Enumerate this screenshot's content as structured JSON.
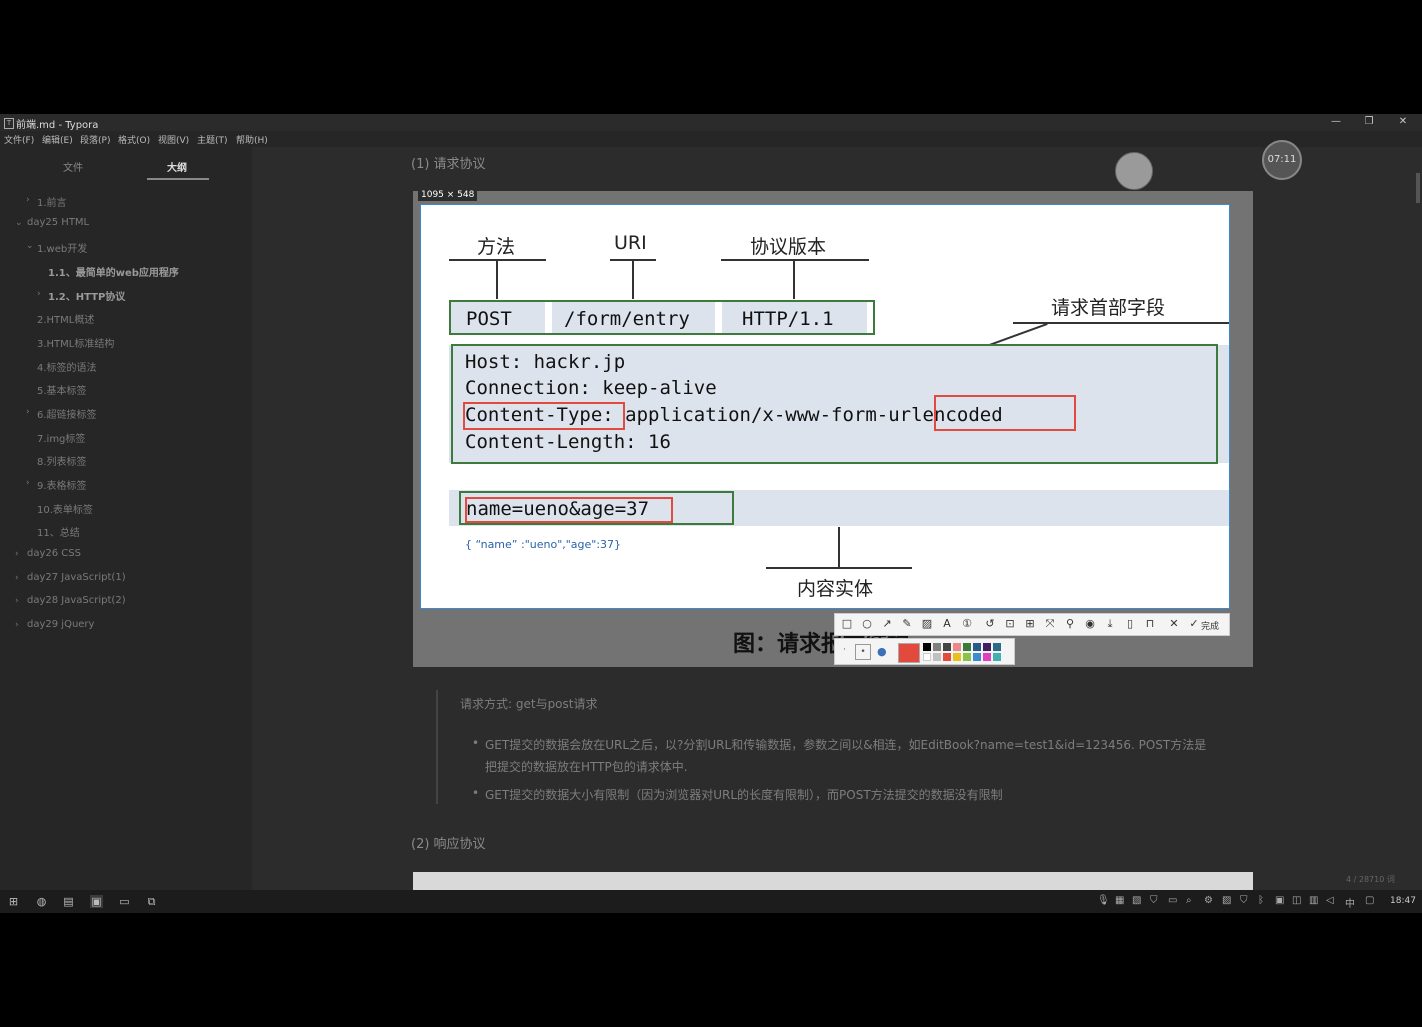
{
  "window": {
    "title": "前端.md - Typora",
    "app_icon": "T"
  },
  "menu": [
    "文件(F)",
    "编辑(E)",
    "段落(P)",
    "格式(O)",
    "视图(V)",
    "主题(T)",
    "帮助(H)"
  ],
  "sidebar": {
    "tabs": [
      "文件",
      "大纲"
    ],
    "outline": [
      "1.前言",
      "day25 HTML",
      "1.web开发",
      "1.1、最简单的web应用程序",
      "1.2、HTTP协议",
      "2.HTML概述",
      "3.HTML标准结构",
      "4.标签的语法",
      "5.基本标签",
      "6.超链接标签",
      "7.img标签",
      "8.列表标签",
      "9.表格标签",
      "10.表单标签",
      "11、总结",
      "day26 CSS",
      "day27 JavaScript(1)",
      "day28 JavaScript(2)",
      "day29 jQuery"
    ]
  },
  "editor": {
    "heading1": "(1) 请求协议",
    "heading2": "(2) 响应协议",
    "image_dims": "1095 × 548",
    "figure": {
      "label_method": "方法",
      "label_uri": "URI",
      "label_version": "协议版本",
      "label_header_fields": "请求首部字段",
      "label_body": "内容实体",
      "req_method": "POST",
      "req_uri": "/form/entry",
      "req_version": "HTTP/1.1",
      "header_lines": [
        "Host: hackr.jp",
        "Connection: keep-alive",
        "Content-Type: application/x-www-form-urlencoded",
        "Content-Length: 16"
      ],
      "body_line": "name=ueno&age=37",
      "json_note": "{ “name” :\"ueno\",\"age\":37}"
    },
    "caption": "图：请求报文结构",
    "quote": "请求方式: get与post请求",
    "bullets": [
      "GET提交的数据会放在URL之后，以?分割URL和传输数据，参数之间以&相连，如EditBook?name=test1&id=123456. POST方法是",
      "把提交的数据放在HTTP包的请求体中.",
      "GET提交的数据大小有限制（因为浏览器对URL的长度有限制），而POST方法提交的数据没有限制"
    ],
    "word_count": "4 / 28710 词"
  },
  "snap_toolbar": {
    "done_label": "完成"
  },
  "timer_badge": "07:11",
  "clock": "18:47",
  "ime_label": "中",
  "colors": {
    "accent_red": "#e14a3c",
    "box_green": "#3d7a3d",
    "selection_blue": "#3c8bd0"
  }
}
